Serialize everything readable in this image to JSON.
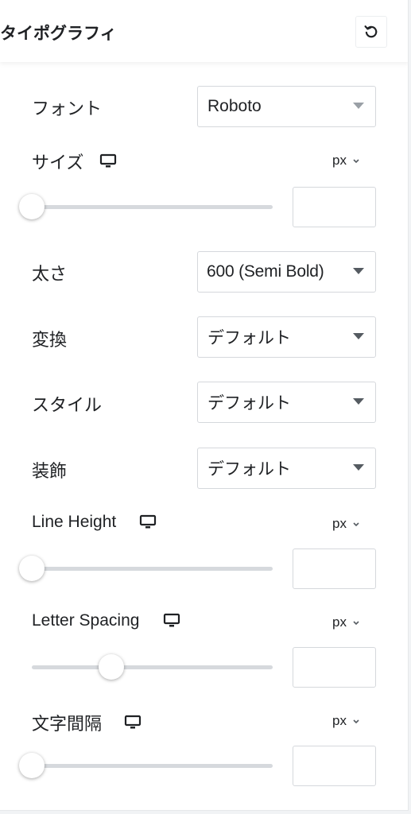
{
  "header": {
    "title": "タイポグラフィ"
  },
  "controls": {
    "font": {
      "label": "フォント",
      "value": "Roboto"
    },
    "size": {
      "label": "サイズ",
      "unit": "px",
      "slider_fraction": 0.0,
      "value": ""
    },
    "weight": {
      "label": "太さ",
      "value": "600 (Semi Bold)"
    },
    "transform": {
      "label": "変換",
      "value": "デフォルト"
    },
    "style": {
      "label": "スタイル",
      "value": "デフォルト"
    },
    "decoration": {
      "label": "装飾",
      "value": "デフォルト"
    },
    "line_height": {
      "label": "Line Height",
      "unit": "px",
      "slider_fraction": 0.0,
      "value": ""
    },
    "letter_spacing": {
      "label": "Letter Spacing",
      "unit": "px",
      "slider_fraction": 0.33,
      "value": ""
    },
    "word_spacing": {
      "label": "文字間隔",
      "unit": "px",
      "slider_fraction": 0.0,
      "value": ""
    }
  },
  "icons": {
    "reset": "reset-icon",
    "responsive": "desktop-monitor-icon",
    "dropdown": "caret-down-icon",
    "unit_dropdown": "chevron-down-icon"
  }
}
